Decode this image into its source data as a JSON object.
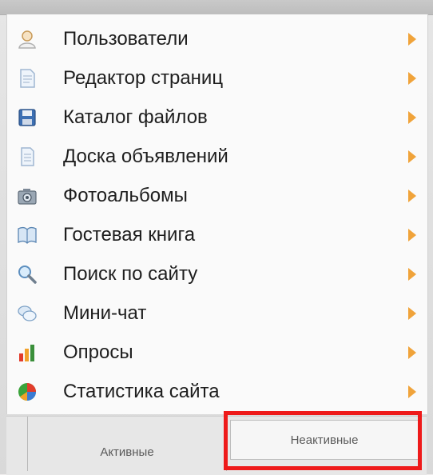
{
  "menu": {
    "items": [
      {
        "label": "Пользователи",
        "icon": "user-icon"
      },
      {
        "label": "Редактор страниц",
        "icon": "page-icon"
      },
      {
        "label": "Каталог файлов",
        "icon": "floppy-disk-icon"
      },
      {
        "label": "Доска объявлений",
        "icon": "document-icon"
      },
      {
        "label": "Фотоальбомы",
        "icon": "camera-icon"
      },
      {
        "label": "Гостевая книга",
        "icon": "book-icon"
      },
      {
        "label": "Поиск по сайту",
        "icon": "search-icon"
      },
      {
        "label": "Мини-чат",
        "icon": "chat-icon"
      },
      {
        "label": "Опросы",
        "icon": "bar-chart-icon"
      },
      {
        "label": "Статистика сайта",
        "icon": "pie-chart-icon"
      }
    ]
  },
  "tabs": {
    "active_label": "Активные",
    "inactive_label": "Неактивные"
  },
  "colors": {
    "arrow": "#f0a33a",
    "highlight": "#ee1a1a"
  }
}
